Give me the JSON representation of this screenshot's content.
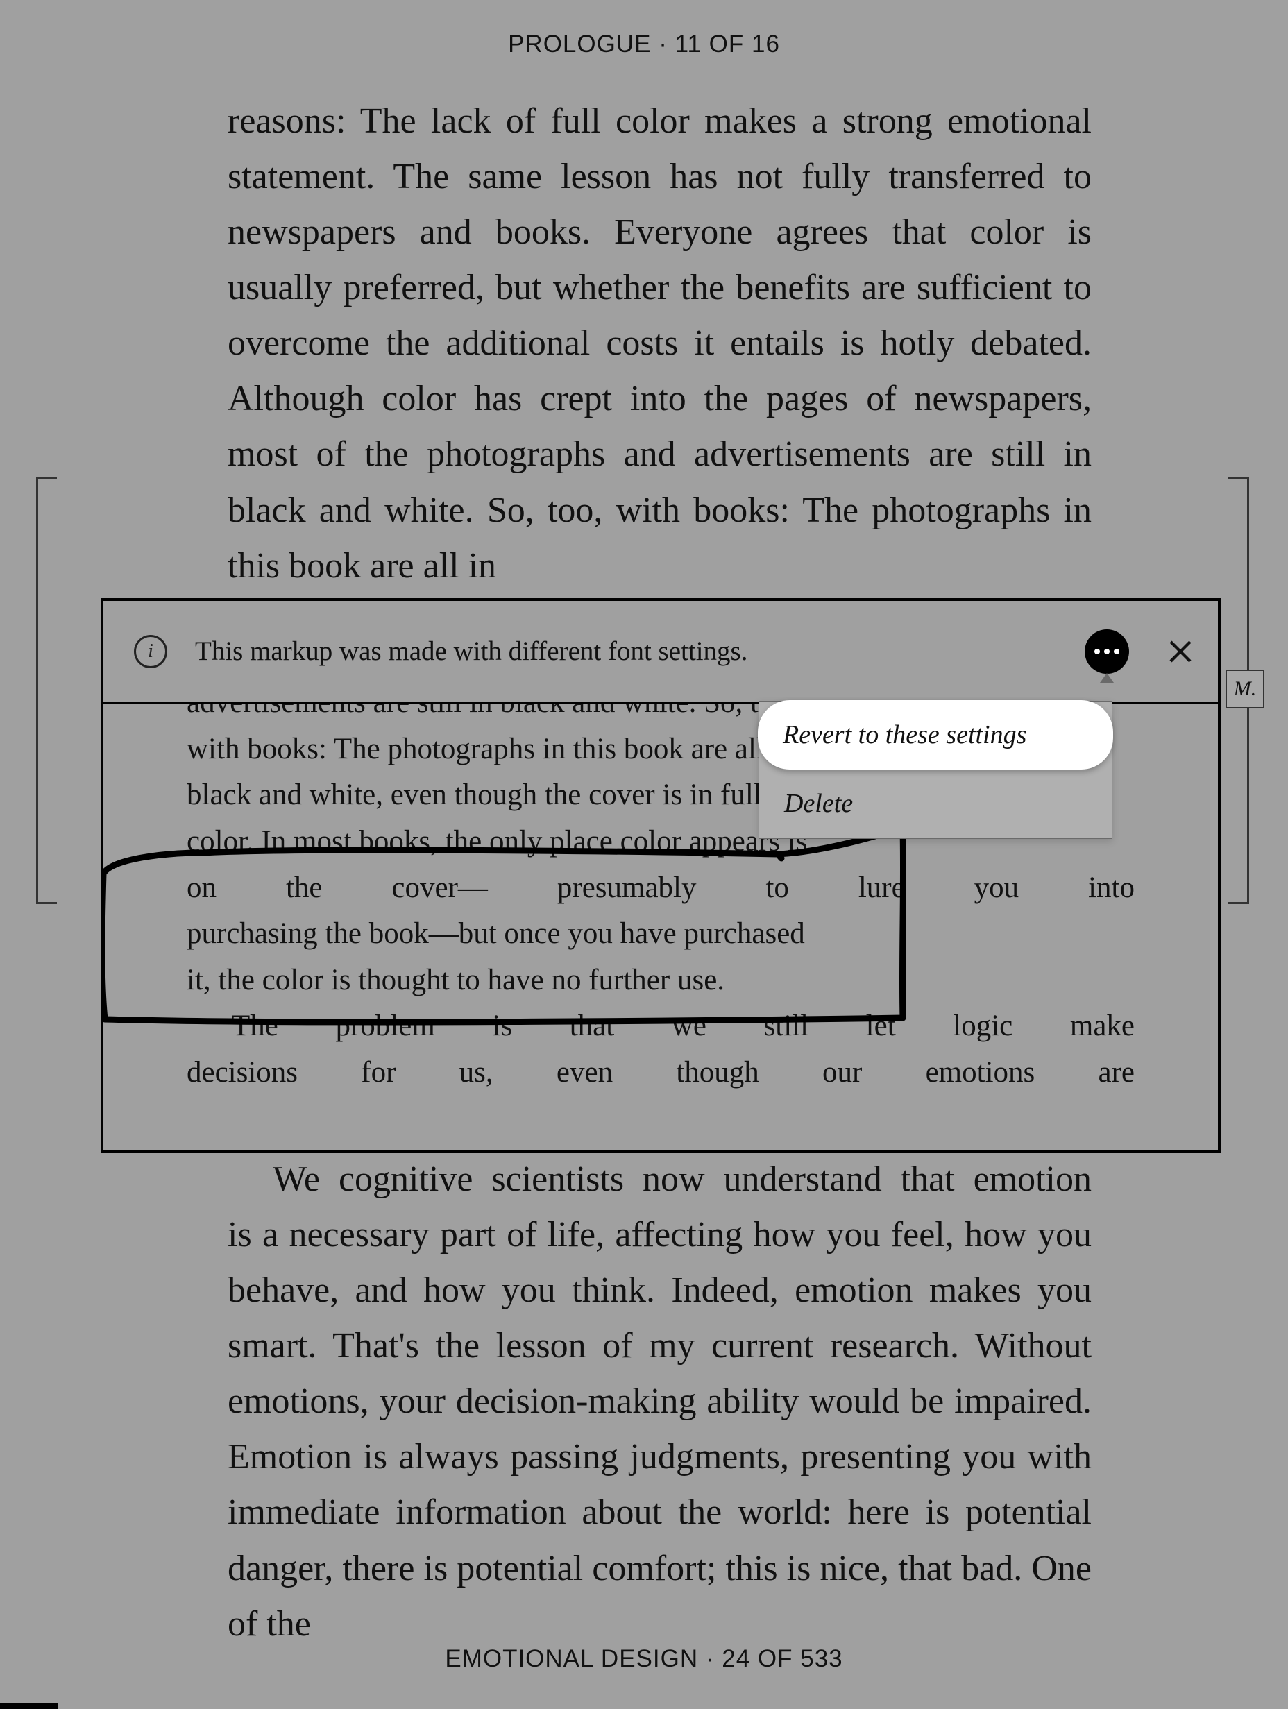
{
  "header": {
    "chapter": "PROLOGUE",
    "separator": "·",
    "page_in_chapter": "11 OF 16"
  },
  "footer": {
    "book_title": "EMOTIONAL DESIGN",
    "separator": "·",
    "page_in_book": "24 OF 533"
  },
  "main_text_top": "reasons: The lack of full color makes a strong emotional statement. The same lesson has not fully transferred to newspapers and books. Everyone agrees that color is usually preferred, but whether the benefits are sufficient to overcome the additional costs it entails is hotly debated. Although color has crept into the pages of newspapers, most of the photographs and advertisements are still in black and white. So, too, with books: The photographs in this book are all in",
  "main_text_bottom_line1": "We cognitive scientists now understand that emotion",
  "main_text_bottom_rest": "is a necessary part of life, affecting how you feel, how you behave, and how you think. Indeed, emotion makes you smart. That's the lesson of my current research. Without emotions, your decision-making ability would be impaired. Emotion is always passing judgments, presenting you with immediate information about the world: here is potential danger, there is potential comfort; this is nice, that bad. One of the",
  "overlay": {
    "message": "This markup was made with different font settings.",
    "body_line1": "advertisements are still in black and white. So, too,",
    "body_line2": "with books: The photographs in this book are all in",
    "body_line3": "black and white, even though the cover is in full",
    "body_line4": "color. In most books, the only place color appears is",
    "body_line5": "on the cover— presumably to lure you into",
    "body_line6": "purchasing the book—but once you have purchased",
    "body_line7": "it, the color is thought to have no further use.",
    "body_para2_a": "The problem is that we still let logic make",
    "body_para2_b": "decisions for us, even though our emotions are"
  },
  "popover": {
    "revert": "Revert to these settings",
    "delete": "Delete"
  },
  "signature_label": "M."
}
